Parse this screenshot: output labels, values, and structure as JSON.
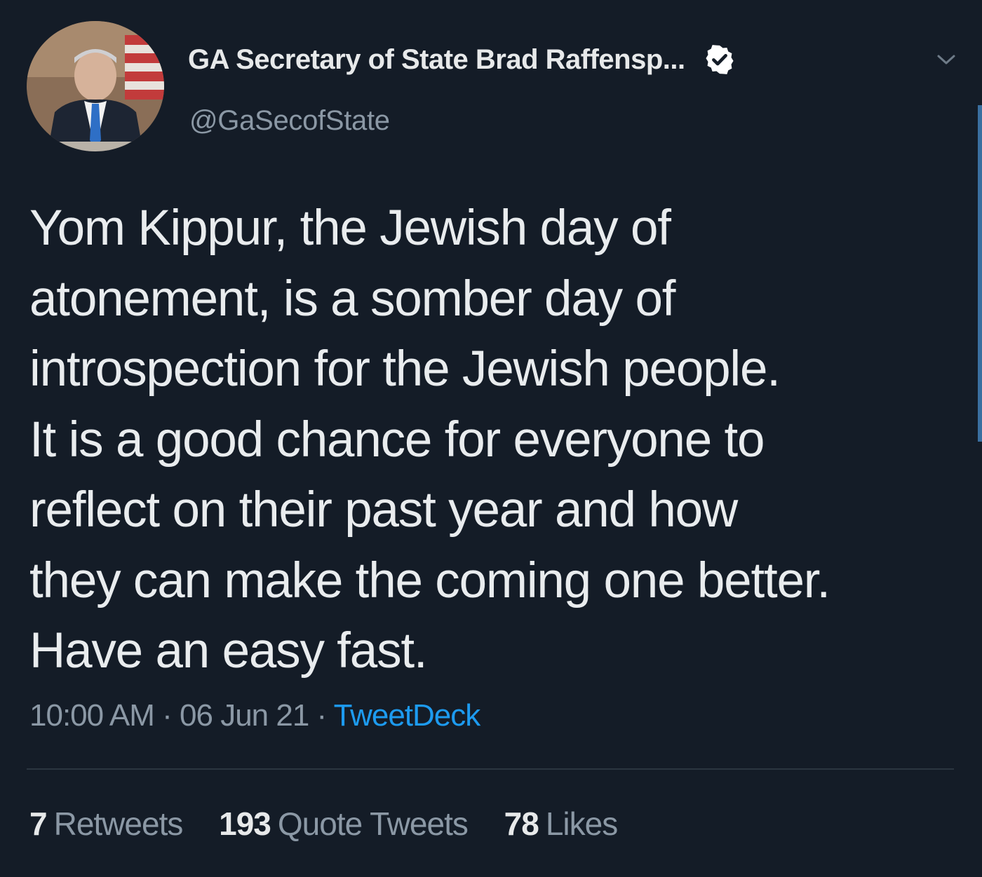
{
  "account": {
    "display_name": "GA Secretary of State Brad Raffensp...",
    "handle": "@GaSecofState",
    "verified_icon": "verified-badge-icon",
    "menu_icon": "chevron-down-icon"
  },
  "tweet": {
    "lines": [
      "Yom Kippur, the Jewish day of",
      "atonement, is a somber day of",
      "introspection for the Jewish people.",
      "It is a good chance for everyone to",
      "reflect on their past year and how",
      "they can make the coming one better.",
      "Have an easy fast."
    ],
    "time": "10:00 AM",
    "separator": "·",
    "date": "06 Jun 21",
    "source": "TweetDeck"
  },
  "stats": {
    "retweets_count": "7",
    "retweets_label": "Retweets",
    "quotes_count": "193",
    "quotes_label": "Quote Tweets",
    "likes_count": "78",
    "likes_label": "Likes"
  },
  "colors": {
    "background": "#141c27",
    "text": "#e7e9ea",
    "muted": "#8b98a5",
    "link": "#1d9bf0"
  }
}
